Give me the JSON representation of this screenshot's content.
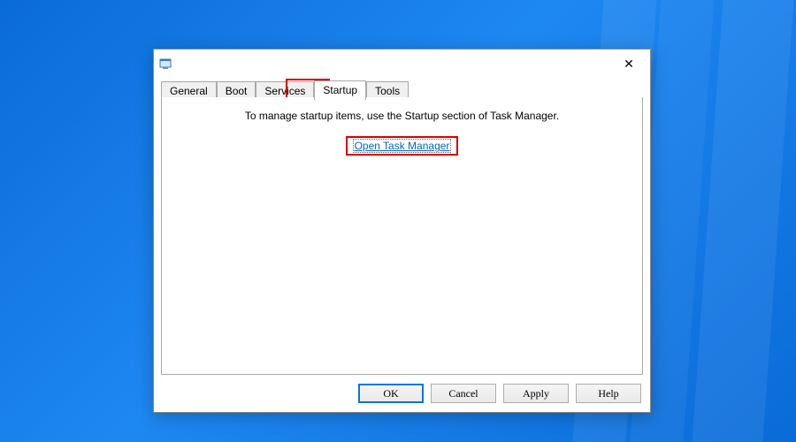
{
  "tabs": {
    "general": "General",
    "boot": "Boot",
    "services": "Services",
    "startup": "Startup",
    "tools": "Tools",
    "active": "startup"
  },
  "content": {
    "instruction": "To manage startup items, use the Startup section of Task Manager.",
    "link": "Open Task Manager"
  },
  "buttons": {
    "ok": "OK",
    "cancel": "Cancel",
    "apply": "Apply",
    "help": "Help"
  }
}
